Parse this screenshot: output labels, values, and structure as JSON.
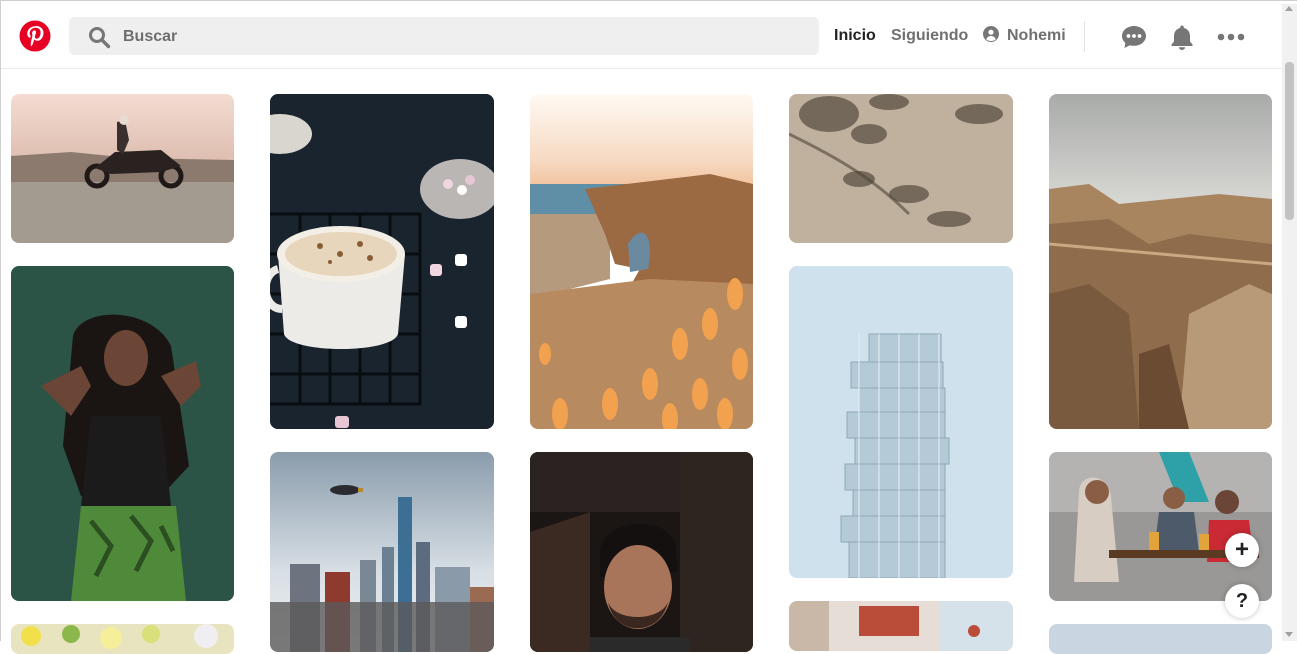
{
  "app": {
    "name": "Pinterest",
    "brand_color": "#e60023"
  },
  "search": {
    "placeholder": "Buscar"
  },
  "nav": {
    "home": "Inicio",
    "following": "Siguiendo",
    "user": "Nohemi"
  },
  "header_icons": [
    "messages-icon",
    "notifications-icon",
    "more-icon"
  ],
  "feed": {
    "pins": [
      {
        "id": "pin-motorcycle",
        "subject": "motorcycle rider at sunset"
      },
      {
        "id": "pin-woman-green",
        "subject": "woman portrait on green"
      },
      {
        "id": "pin-flowers",
        "subject": "flowers"
      },
      {
        "id": "pin-coffee",
        "subject": "coffee cup with marshmallows"
      },
      {
        "id": "pin-city",
        "subject": "city skyline with blimp"
      },
      {
        "id": "pin-beach",
        "subject": "beach arch at sunset"
      },
      {
        "id": "pin-man-portrait",
        "subject": "man portrait"
      },
      {
        "id": "pin-shadows",
        "subject": "leaf shadows on wall"
      },
      {
        "id": "pin-tower",
        "subject": "tall stacked tower"
      },
      {
        "id": "pin-interior",
        "subject": "interior"
      },
      {
        "id": "pin-canyon",
        "subject": "desert canyon"
      },
      {
        "id": "pin-friends",
        "subject": "friends at a table"
      },
      {
        "id": "pin-sky",
        "subject": "sky"
      }
    ]
  },
  "fab": {
    "add": "+",
    "help": "?"
  }
}
